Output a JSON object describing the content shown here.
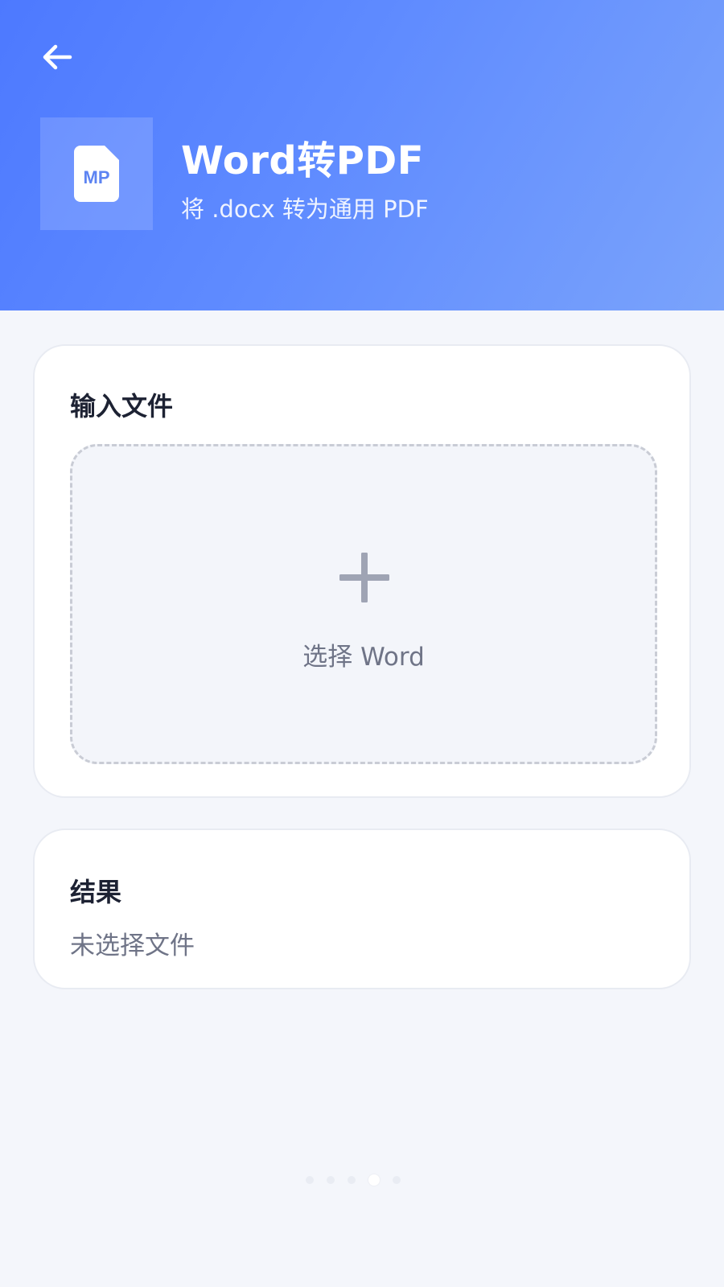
{
  "header": {
    "back_icon": "arrow-left-icon",
    "app_icon": "word-file-icon",
    "app_icon_text": "MP",
    "title": "Word转PDF",
    "subtitle": "将 .docx 转为通用 PDF"
  },
  "input_card": {
    "title": "输入文件",
    "drop_icon": "plus-icon",
    "drop_label": "选择 Word"
  },
  "result_card": {
    "title": "结果",
    "status": "未选择文件"
  },
  "pager": {
    "total": 5,
    "active_index": 3
  },
  "colors": {
    "header_gradient_start": "#4d79ff",
    "header_gradient_end": "#7aa3fb",
    "background": "#f4f6fb",
    "card_background": "#ffffff",
    "title_text": "#1d2233",
    "secondary_text": "#6f7487"
  }
}
